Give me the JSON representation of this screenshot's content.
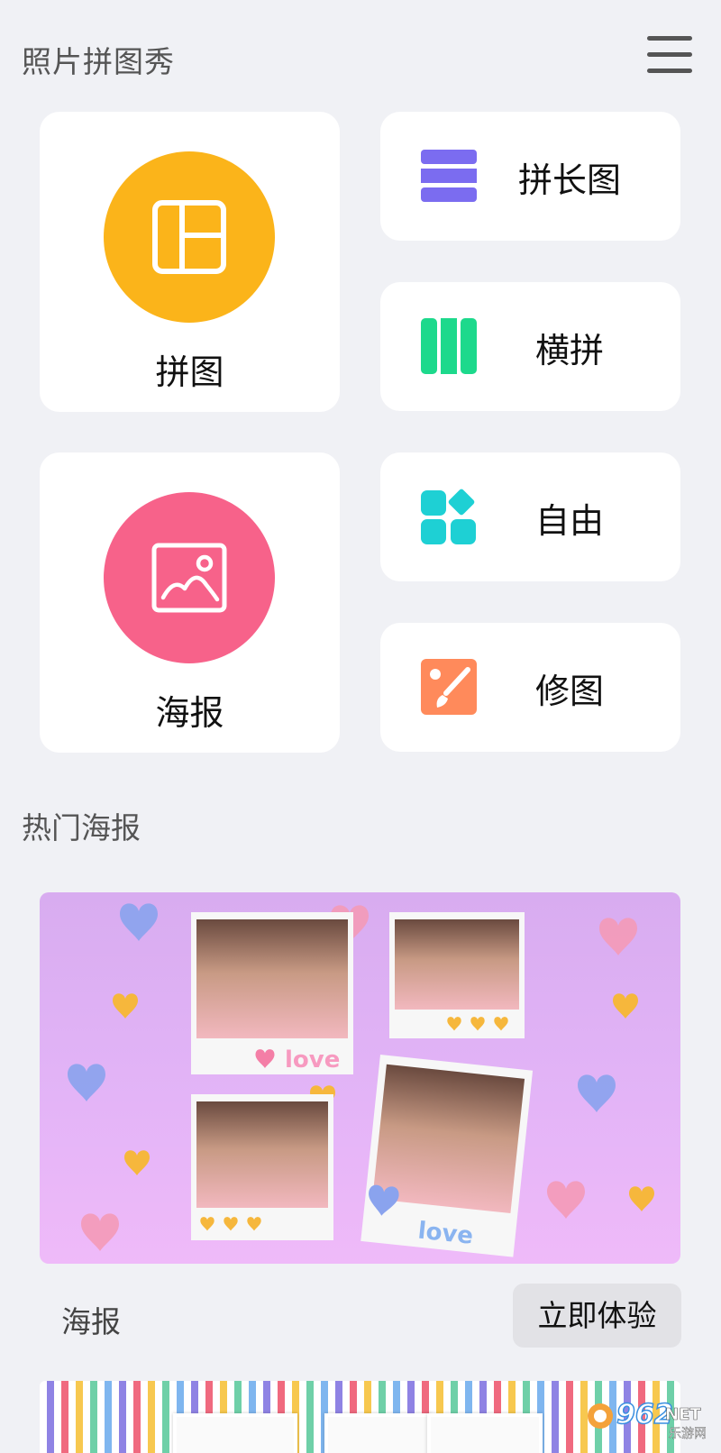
{
  "header": {
    "title": "照片拼图秀",
    "menu_icon": "hamburger-menu-icon"
  },
  "tools": {
    "collage": {
      "label": "拼图",
      "icon": "collage-grid-icon",
      "color": "#FBB41A"
    },
    "poster": {
      "label": "海报",
      "icon": "image-icon",
      "color": "#F7628A"
    },
    "long_stitch": {
      "label": "拼长图",
      "icon": "horizontal-stripes-icon",
      "color": "#7B6CF0"
    },
    "horizontal_stitch": {
      "label": "横拼",
      "icon": "vertical-stripes-icon",
      "color": "#1DD98C"
    },
    "free": {
      "label": "自由",
      "icon": "free-layout-icon",
      "color": "#1ED0D4"
    },
    "edit": {
      "label": "修图",
      "icon": "brush-edit-icon",
      "color": "#FF8A5B"
    }
  },
  "hot_posters": {
    "title": "热门海报",
    "items": [
      {
        "name": "海报",
        "action": "立即体验",
        "photo_captions": [
          "love",
          "love"
        ]
      }
    ]
  },
  "watermark": {
    "number": "962",
    "suffix": "NET",
    "site": "乐游网"
  }
}
